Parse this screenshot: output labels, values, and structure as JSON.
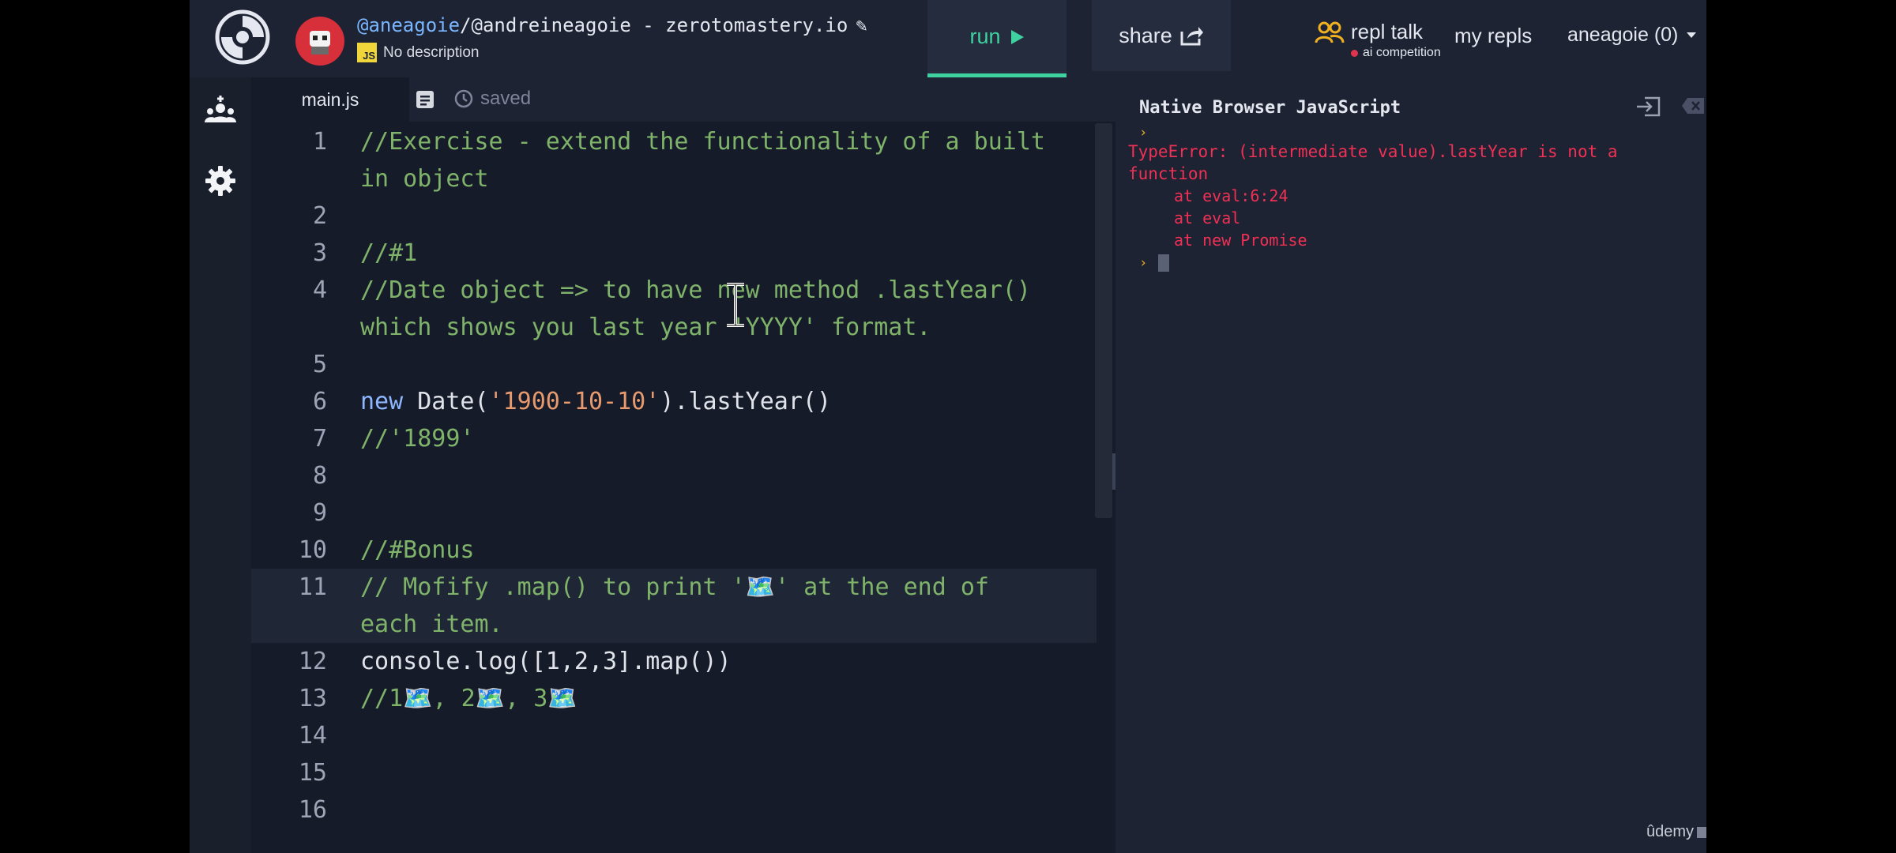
{
  "header": {
    "repl_user": "@aneagoie",
    "repl_path": "/@andreineagoie - zerotomastery.io",
    "description": "No description",
    "js_badge": "JS",
    "run_label": "run",
    "share_label": "share",
    "repl_talk_label": "repl talk",
    "repl_talk_sub": "ai competition",
    "my_repls_label": "my repls",
    "user_menu_label": "aneagoie (0)"
  },
  "editor": {
    "file_tab": "main.js",
    "saved_label": "saved",
    "lines": [
      {
        "n": "1",
        "text": "//Exercise - extend the functionality of a built in object"
      },
      {
        "n": "2",
        "text": ""
      },
      {
        "n": "3",
        "text": "//#1"
      },
      {
        "n": "4",
        "text": "//Date object => to have new method .lastYear() which shows you last year 'YYYY' format."
      },
      {
        "n": "5",
        "text": ""
      },
      {
        "n": "6",
        "kw": "new ",
        "plain": "Date(",
        "str": "'1900-10-10'",
        "plain2": ").lastYear()"
      },
      {
        "n": "7",
        "text": "//'1899'"
      },
      {
        "n": "8",
        "text": ""
      },
      {
        "n": "9",
        "text": ""
      },
      {
        "n": "10",
        "text": "//#Bonus"
      },
      {
        "n": "11",
        "text": "// Mofify .map() to print '🗺️' at the end of each item."
      },
      {
        "n": "12",
        "plain": "console.log([1,2,3].map())"
      },
      {
        "n": "13",
        "text": "//1🗺️, 2🗺️, 3🗺️"
      },
      {
        "n": "14",
        "text": ""
      },
      {
        "n": "15",
        "text": ""
      },
      {
        "n": "16",
        "text": ""
      }
    ]
  },
  "console": {
    "title": "Native Browser JavaScript",
    "error": "TypeError: (intermediate value).lastYear is not a function",
    "trace": [
      "at eval:6:24",
      "at eval",
      "at new Promise"
    ]
  },
  "watermark": "ûdemy",
  "colors": {
    "run_accent": "#3fd1a0",
    "error": "#f03055",
    "comment": "#7fb36a",
    "keyword": "#8fb7ff",
    "string": "#e79a6e"
  }
}
